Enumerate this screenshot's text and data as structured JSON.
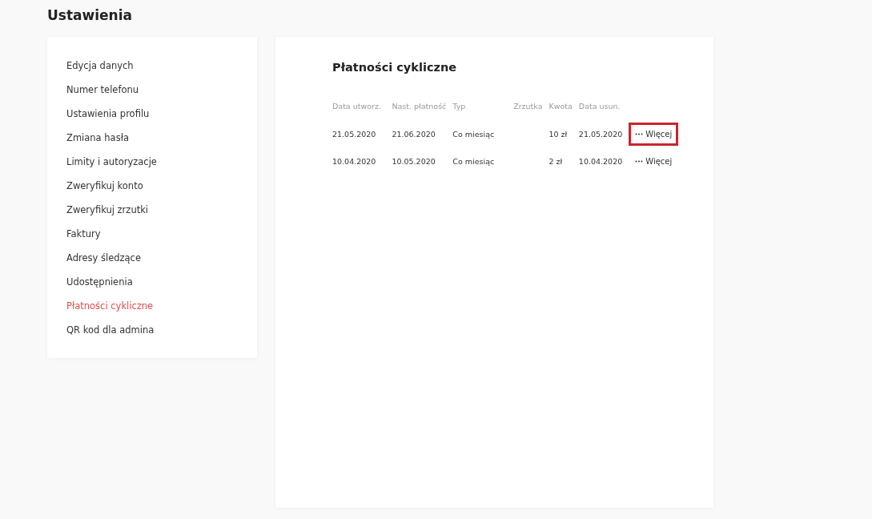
{
  "page_title": "Ustawienia",
  "sidebar": {
    "items": [
      {
        "label": "Edycja danych",
        "selected": false
      },
      {
        "label": "Numer telefonu",
        "selected": false
      },
      {
        "label": "Ustawienia profilu",
        "selected": false
      },
      {
        "label": "Zmiana hasła",
        "selected": false
      },
      {
        "label": "Limity i autoryzacje",
        "selected": false
      },
      {
        "label": "Zweryfikuj konto",
        "selected": false
      },
      {
        "label": "Zweryfikuj zrzutki",
        "selected": false
      },
      {
        "label": "Faktury",
        "selected": false
      },
      {
        "label": "Adresy śledzące",
        "selected": false
      },
      {
        "label": "Udostępnienia",
        "selected": false
      },
      {
        "label": "Płatności cykliczne",
        "selected": true
      },
      {
        "label": "QR kod dla admina",
        "selected": false
      }
    ]
  },
  "panel": {
    "title": "Płatności cykliczne",
    "table": {
      "columns": [
        "Data utworz.",
        "Nast. płatność",
        "Typ",
        "Zrzutka",
        "Kwota",
        "Data usun."
      ],
      "rows": [
        {
          "cells": [
            "21.05.2020",
            "21.06.2020",
            "Co miesiąc",
            "",
            "10 zł",
            "21.05.2020"
          ],
          "more_label": "Więcej",
          "highlighted": true
        },
        {
          "cells": [
            "10.04.2020",
            "10.05.2020",
            "Co miesiąc",
            "",
            "2 zł",
            "10.04.2020"
          ],
          "more_label": "Więcej",
          "highlighted": false
        }
      ]
    }
  }
}
